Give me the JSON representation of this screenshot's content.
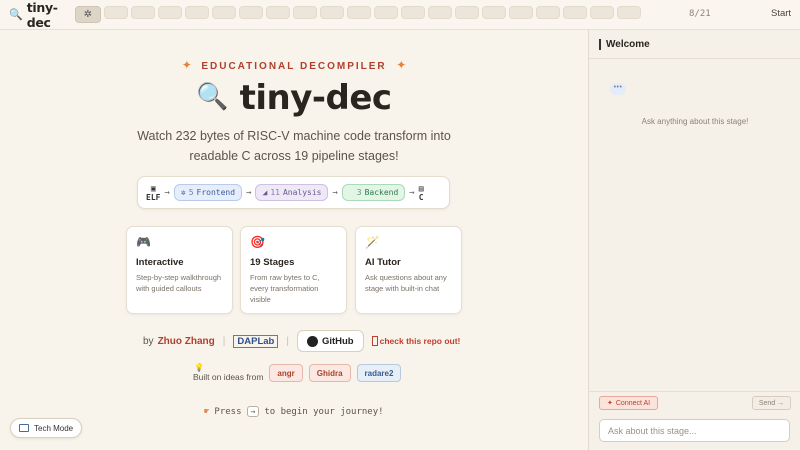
{
  "topbar": {
    "app_name": "tiny-dec",
    "brand_icon": "magnifier-icon",
    "active_stage_icon": "gear-icon",
    "stage_count_display": "8/21",
    "start_label": "Start"
  },
  "hero": {
    "eyebrow": "EDUCATIONAL DECOMPILER",
    "title": "tiny-dec",
    "subtitle": "Watch 232 bytes of RISC-V machine code transform into readable C across 19 pipeline stages!"
  },
  "pipeline": {
    "start_label": "ELF",
    "end_label": "C",
    "frontend": {
      "count": "5",
      "label": "Frontend"
    },
    "analysis": {
      "count": "11",
      "label": "Analysis"
    },
    "backend": {
      "count": "3",
      "label": "Backend"
    }
  },
  "cards": [
    {
      "icon": "gamepad-icon",
      "title": "Interactive",
      "desc": "Step-by-step walkthrough with guided callouts"
    },
    {
      "icon": "target-icon",
      "title": "19 Stages",
      "desc": "From raw bytes to C, every transformation visible"
    },
    {
      "icon": "magic-wand-icon",
      "title": "AI Tutor",
      "desc": "Ask questions about any stage with built-in chat"
    }
  ],
  "credits": {
    "by_label": "by",
    "author": "Zhuo Zhang",
    "lab": "DAPLab",
    "github_label": "GitHub",
    "check_repo": "check this repo out!"
  },
  "built_on": {
    "label": "Built on ideas from",
    "tools": [
      "angr",
      "Ghidra",
      "radare2"
    ]
  },
  "press_hint": {
    "before": "Press",
    "key": "→",
    "after": "to begin your journey!"
  },
  "tech_mode_label": "Tech Mode",
  "chat": {
    "title": "Welcome",
    "empty_hint": "Ask anything about this stage!",
    "connect_label": "Connect AI",
    "send_label": "Send →",
    "input_placeholder": "Ask about this stage..."
  },
  "colors": {
    "accent": "#b0402b",
    "background": "#f8f4ec",
    "frontend": "#3b5c9a",
    "analysis": "#6b5a92",
    "backend": "#2f7a45"
  }
}
